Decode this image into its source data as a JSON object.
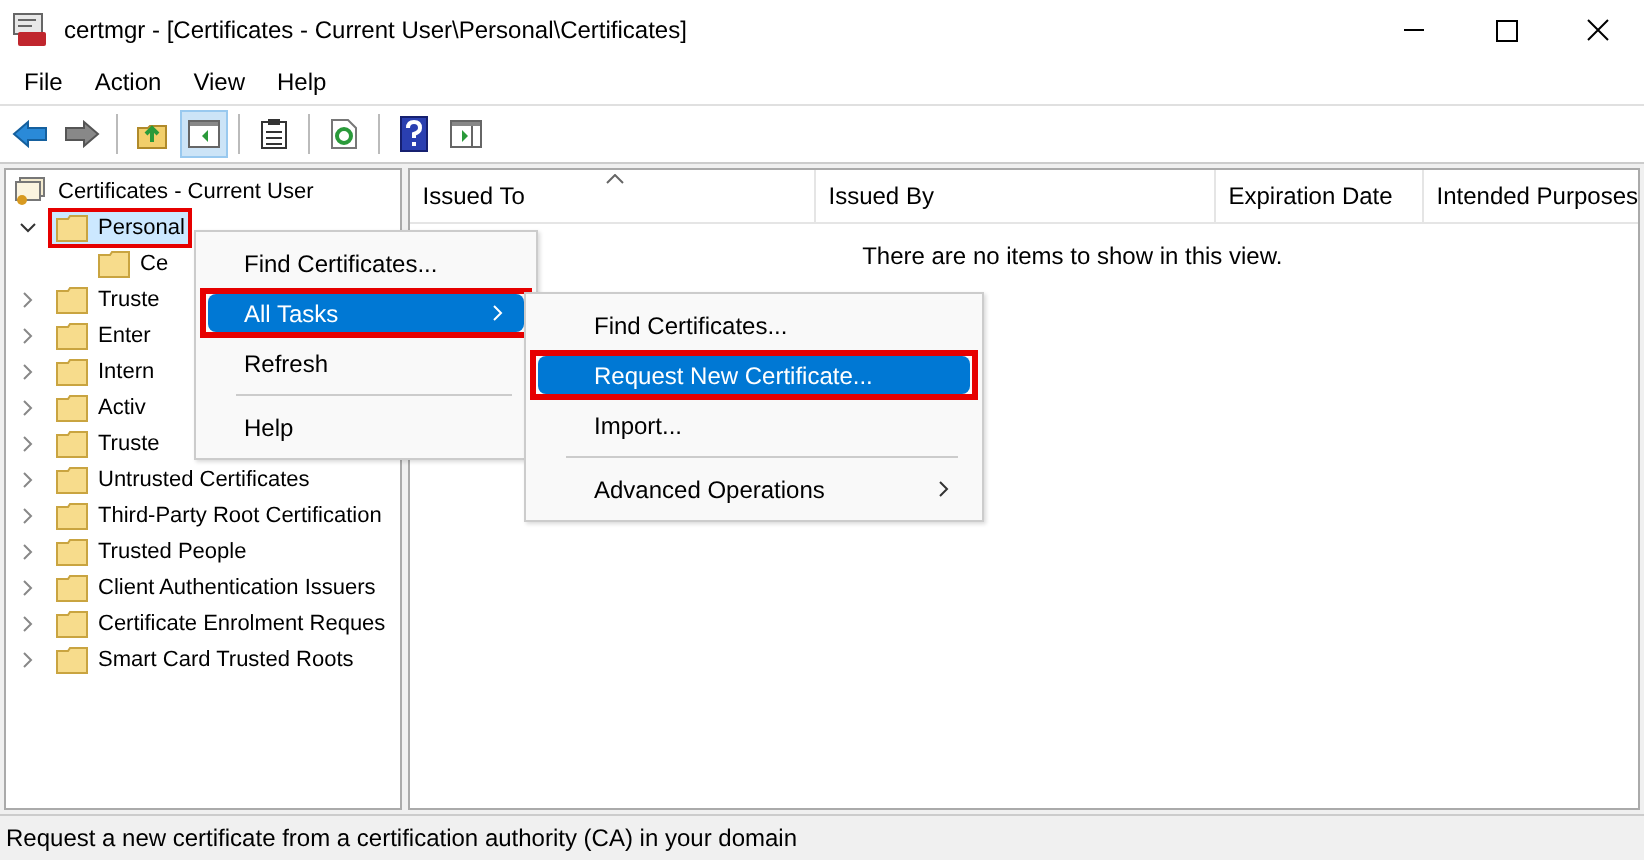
{
  "window": {
    "title": "certmgr - [Certificates - Current User\\Personal\\Certificates]"
  },
  "menu_bar": [
    "File",
    "Action",
    "View",
    "Help"
  ],
  "toolbar": [
    {
      "kind": "back",
      "selected": false
    },
    {
      "kind": "forward",
      "selected": false
    },
    {
      "kind": "sep"
    },
    {
      "kind": "up",
      "selected": false
    },
    {
      "kind": "tree",
      "selected": true
    },
    {
      "kind": "sep"
    },
    {
      "kind": "clipboard",
      "selected": false
    },
    {
      "kind": "sep"
    },
    {
      "kind": "refresh",
      "selected": false
    },
    {
      "kind": "sep"
    },
    {
      "kind": "help",
      "selected": false
    },
    {
      "kind": "panel",
      "selected": false
    }
  ],
  "tree": {
    "root": "Certificates - Current User",
    "items": [
      {
        "label": "Personal",
        "expanded": true,
        "selected": true,
        "highlighted": true,
        "children": [
          {
            "label": "Ce",
            "selected": false,
            "highlighted": false
          }
        ]
      },
      {
        "label": "Truste",
        "expanded": false,
        "selected": false,
        "highlighted": false
      },
      {
        "label": "Enter",
        "expanded": false,
        "selected": false,
        "highlighted": false
      },
      {
        "label": "Intern",
        "expanded": false,
        "selected": false,
        "highlighted": false
      },
      {
        "label": "Activ",
        "expanded": false,
        "selected": false,
        "highlighted": false
      },
      {
        "label": "Truste",
        "expanded": false,
        "selected": false,
        "highlighted": false
      },
      {
        "label": "Untrusted Certificates",
        "expanded": false,
        "selected": false,
        "highlighted": false
      },
      {
        "label": "Third-Party Root Certification",
        "expanded": false,
        "selected": false,
        "highlighted": false
      },
      {
        "label": "Trusted People",
        "expanded": false,
        "selected": false,
        "highlighted": false
      },
      {
        "label": "Client Authentication Issuers",
        "expanded": false,
        "selected": false,
        "highlighted": false
      },
      {
        "label": "Certificate Enrolment Reques",
        "expanded": false,
        "selected": false,
        "highlighted": false
      },
      {
        "label": "Smart Card Trusted Roots",
        "expanded": false,
        "selected": false,
        "highlighted": false
      }
    ]
  },
  "table": {
    "columns": [
      "Issued To",
      "Issued By",
      "Expiration Date",
      "Intended Purposes"
    ],
    "empty_message": "There are no items to show in this view."
  },
  "context_menu": {
    "items": [
      {
        "kind": "item",
        "label": "Find Certificates...",
        "selected": false,
        "highlighted": false,
        "submenu": false
      },
      {
        "kind": "item",
        "label": "All Tasks",
        "selected": true,
        "highlighted": true,
        "submenu": true
      },
      {
        "kind": "item",
        "label": "Refresh",
        "selected": false,
        "highlighted": false,
        "submenu": false
      },
      {
        "kind": "separator"
      },
      {
        "kind": "item",
        "label": "Help",
        "selected": false,
        "highlighted": false,
        "submenu": false
      }
    ]
  },
  "submenu": {
    "items": [
      {
        "kind": "item",
        "label": "Find Certificates...",
        "selected": false,
        "highlighted": false,
        "submenu": false
      },
      {
        "kind": "item",
        "label": "Request New Certificate...",
        "selected": true,
        "highlighted": true,
        "submenu": false
      },
      {
        "kind": "item",
        "label": "Import...",
        "selected": false,
        "highlighted": false,
        "submenu": false
      },
      {
        "kind": "separator"
      },
      {
        "kind": "item",
        "label": "Advanced Operations",
        "selected": false,
        "highlighted": false,
        "submenu": true
      }
    ]
  },
  "status_bar": "Request a new certificate from a certification authority (CA) in your domain"
}
